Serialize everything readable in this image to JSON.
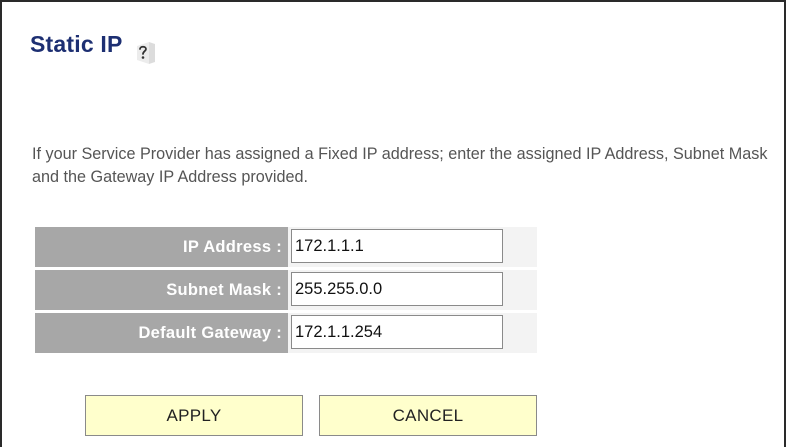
{
  "header": {
    "title": "Static IP",
    "help_icon": "help-question-icon"
  },
  "description": "If your Service Provider has assigned a Fixed IP address; enter the assigned IP Address, Subnet Mask and the Gateway IP Address provided.",
  "form": {
    "fields": [
      {
        "label": "IP Address :",
        "value": "172.1.1.1"
      },
      {
        "label": "Subnet Mask :",
        "value": "255.255.0.0"
      },
      {
        "label": "Default Gateway :",
        "value": "172.1.1.254"
      }
    ]
  },
  "buttons": {
    "apply_label": "APPLY",
    "cancel_label": "CANCEL"
  },
  "colors": {
    "title": "#1d2f72",
    "label_bg": "#a7a7a7",
    "button_bg": "#ffffcc"
  }
}
